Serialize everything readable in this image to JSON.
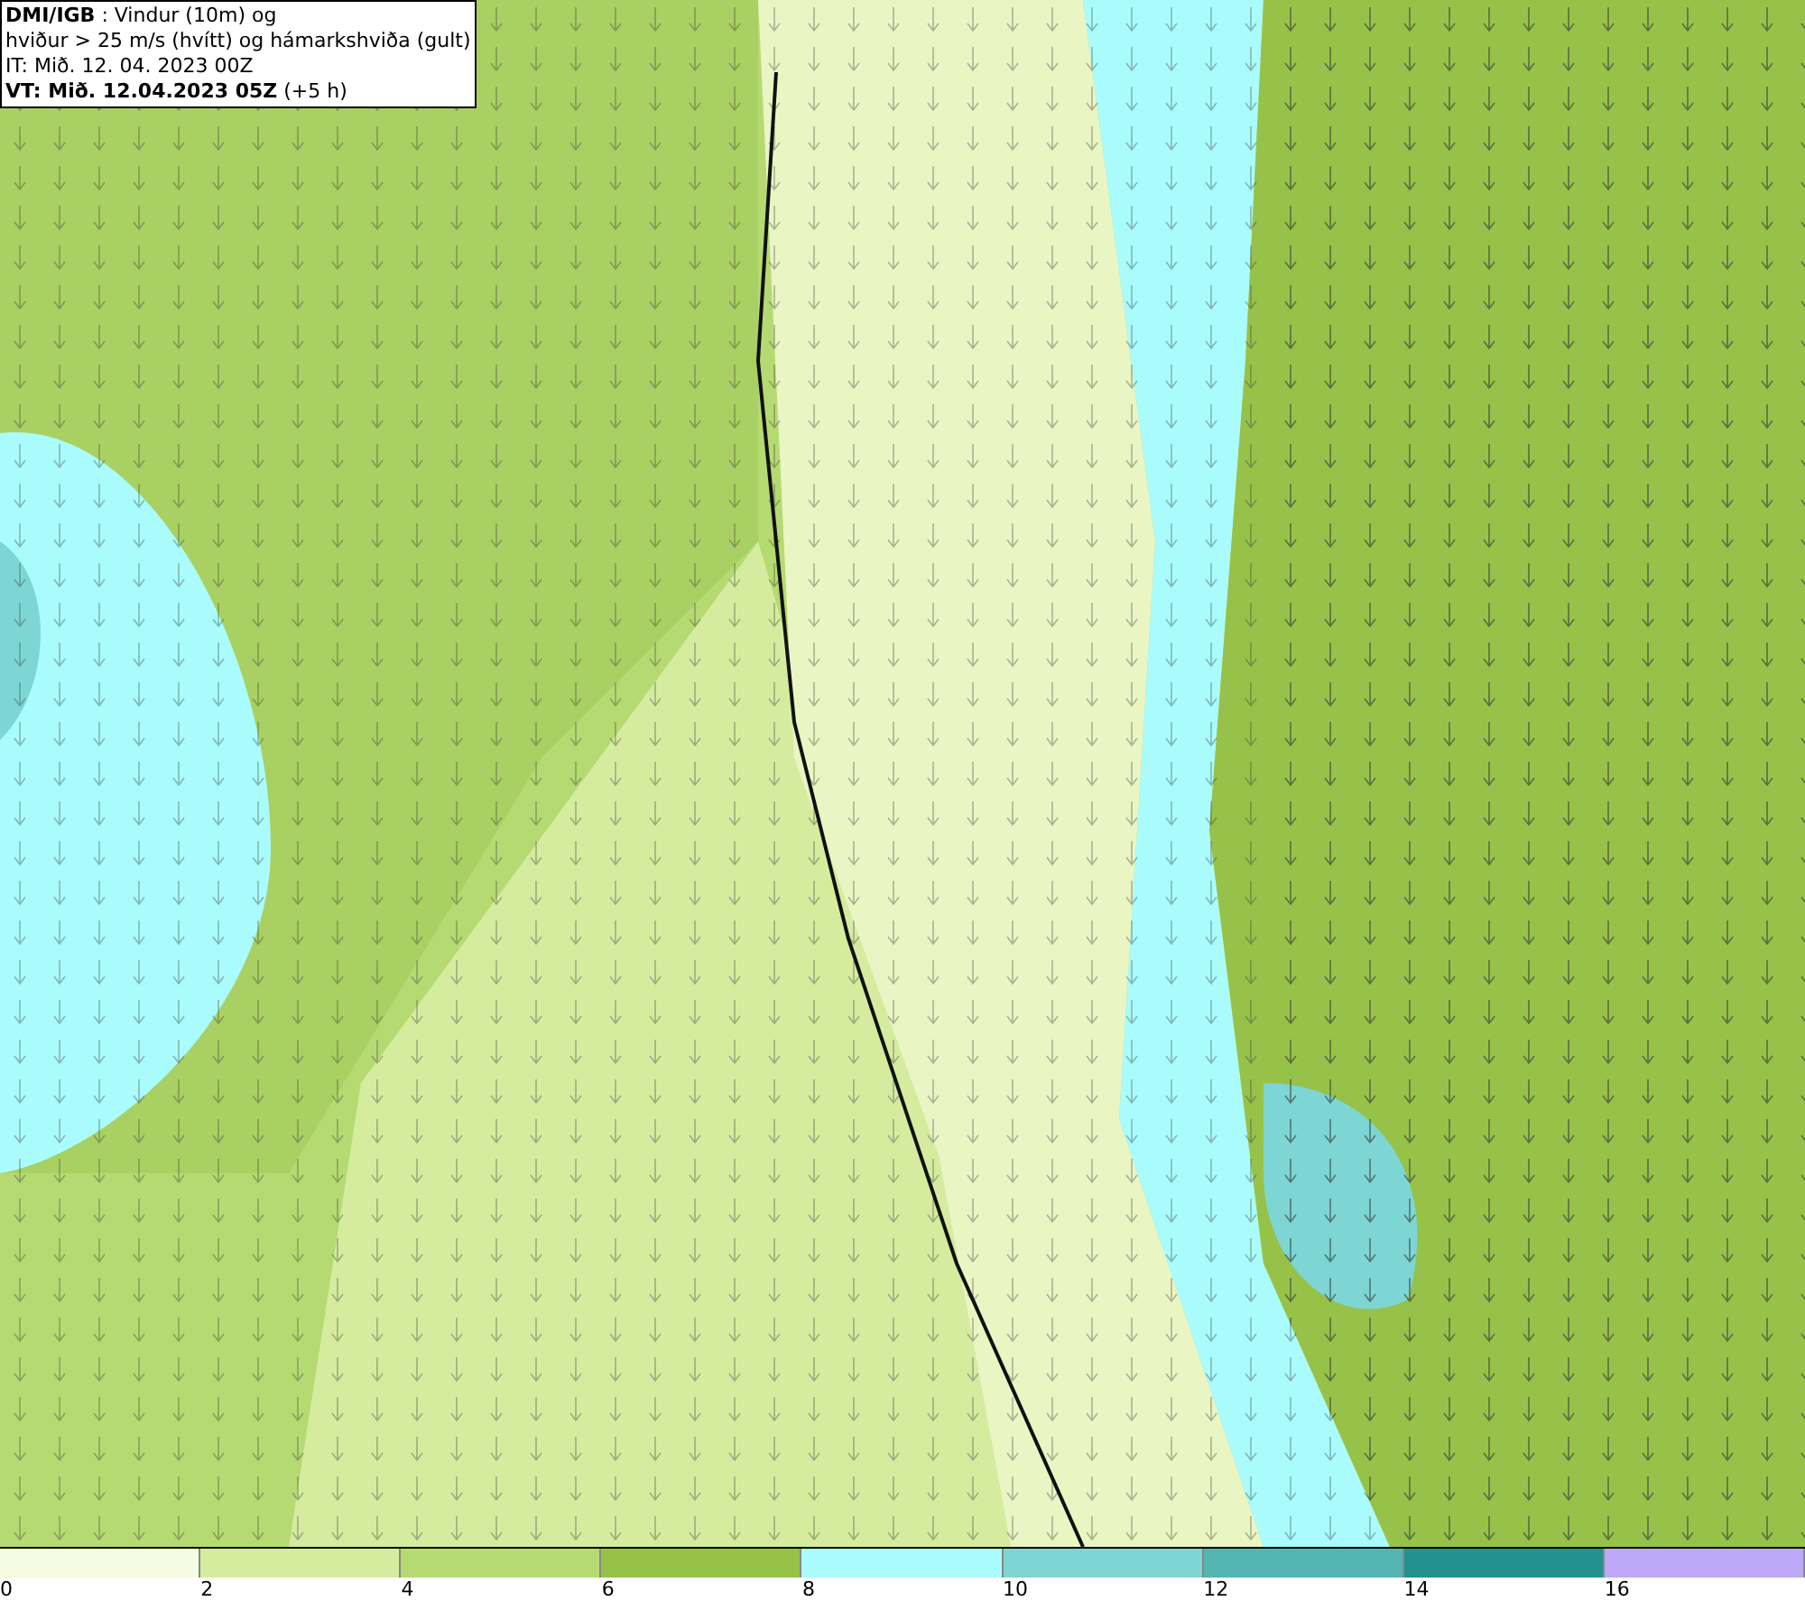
{
  "header": {
    "lines": [
      "**DMI/IGB** : Vindur (10m) og",
      "hviður > 25 m/s (hvítt) og hámarkshviða (gult)",
      "IT: Mið. 12. 04. 2023 00Z",
      "**VT: Mið. 12.04.2023 05Z** (+5 h)"
    ]
  },
  "legend": [
    {
      "label": "0",
      "color": "#f5fbe0"
    },
    {
      "label": "2",
      "color": "#d5ec9f"
    },
    {
      "label": "4",
      "color": "#b6da72"
    },
    {
      "label": "6",
      "color": "#97c24a"
    },
    {
      "label": "8",
      "color": "#aafcfc"
    },
    {
      "label": "10",
      "color": "#7dd6d4"
    },
    {
      "label": "12",
      "color": "#55b5b2"
    },
    {
      "label": "14",
      "color": "#23918f"
    },
    {
      "label": "16",
      "color": "#bda9f8"
    }
  ]
}
